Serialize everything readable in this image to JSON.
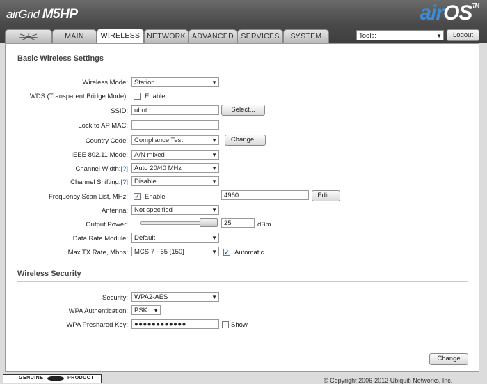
{
  "header": {
    "product_prefix": "airGrid ",
    "product_model": "M5HP",
    "brand_air": "air",
    "brand_os": "OS",
    "trademark": "TM"
  },
  "tabs": [
    {
      "label": "",
      "icon": "ubiquiti-logo-icon"
    },
    {
      "label": "MAIN"
    },
    {
      "label": "WIRELESS",
      "active": true
    },
    {
      "label": "NETWORK"
    },
    {
      "label": "ADVANCED"
    },
    {
      "label": "SERVICES"
    },
    {
      "label": "SYSTEM"
    }
  ],
  "tools": {
    "value": "Tools:"
  },
  "logout_label": "Logout",
  "basic": {
    "title": "Basic Wireless Settings",
    "wireless_mode": {
      "label": "Wireless Mode:",
      "value": "Station"
    },
    "wds": {
      "label": "WDS (Transparent Bridge Mode):",
      "checkbox_label": "Enable",
      "checked": false
    },
    "ssid": {
      "label": "SSID:",
      "value": "ubnt",
      "button": "Select..."
    },
    "lock_ap": {
      "label": "Lock to AP MAC:",
      "value": ""
    },
    "country": {
      "label": "Country Code:",
      "value": "Compliance Test",
      "button": "Change..."
    },
    "ieee": {
      "label": "IEEE 802.11 Mode:",
      "value": "A/N mixed"
    },
    "channel_width": {
      "label": "Channel Width:",
      "help": "[?]",
      "value": "Auto 20/40 MHz"
    },
    "channel_shifting": {
      "label": "Channel Shifting:",
      "help": "[?]",
      "value": "Disable"
    },
    "freq_scan": {
      "label": "Frequency Scan List, MHz:",
      "checkbox_label": "Enable",
      "checked": true,
      "value": "4960",
      "button": "Edit..."
    },
    "antenna": {
      "label": "Antenna:",
      "value": "Not specified"
    },
    "output_power": {
      "label": "Output Power:",
      "value": "25",
      "unit": "dBm",
      "slider_level": 1.0
    },
    "data_rate": {
      "label": "Data Rate Module:",
      "value": "Default"
    },
    "max_tx": {
      "label": "Max TX Rate, Mbps:",
      "value": "MCS 7 - 65 [150]",
      "checkbox_label": "Automatic",
      "checked": true
    }
  },
  "security": {
    "title": "Wireless Security",
    "security": {
      "label": "Security:",
      "value": "WPA2-AES"
    },
    "wpa_auth": {
      "label": "WPA Authentication:",
      "value": "PSK"
    },
    "psk": {
      "label": "WPA Preshared Key:",
      "value": "●●●●●●●●●●●●",
      "checkbox_label": "Show",
      "checked": false
    }
  },
  "change_button": "Change",
  "footer": {
    "badge_left": "GENUINE",
    "badge_right": "PRODUCT",
    "copyright": "© Copyright 2006-2012 Ubiquiti Networks, Inc."
  },
  "colors": {
    "brand_blue": "#3d8ad6",
    "header": "#4a4a4a",
    "help_link": "#2a5fb5"
  }
}
